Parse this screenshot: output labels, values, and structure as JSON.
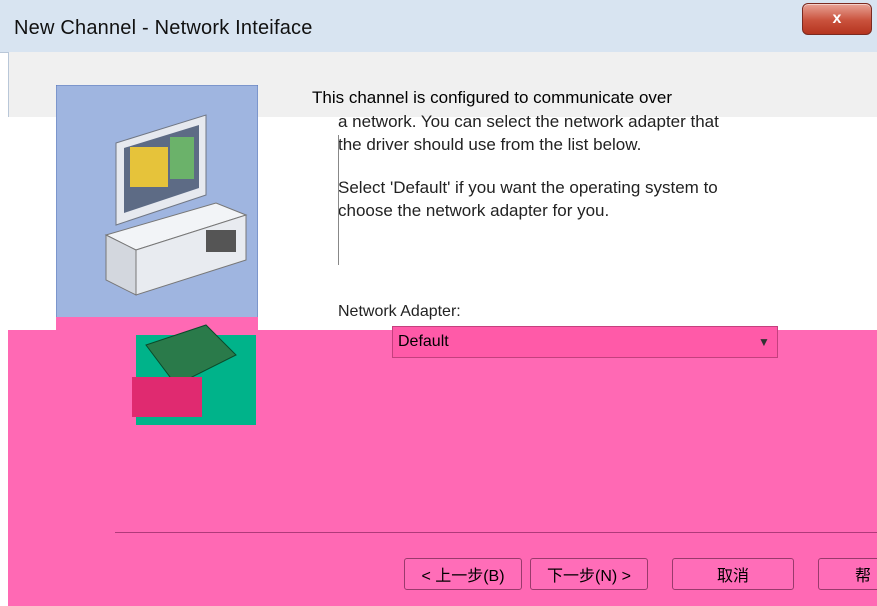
{
  "window": {
    "title": "New Channel - Network Inteiface",
    "close_label": "x"
  },
  "description": {
    "line1": "This channel is configured to communicate over",
    "line2": "a network. You can select the network adapter that the driver should use from the list below.",
    "line3": "Select 'Default' if you want the operating system to choose the network adapter for you."
  },
  "adapter": {
    "label": "Network Adapter:",
    "selected": "Default"
  },
  "buttons": {
    "back": "< 上一步(B)",
    "next": "下一步(N) >",
    "cancel": "取消",
    "help": "帮"
  },
  "colors": {
    "titlebar": "#d8e4f1",
    "close_button": "#c9513c",
    "body_pink": "#ff69b4",
    "illustration_blue": "#9fb5e0"
  }
}
